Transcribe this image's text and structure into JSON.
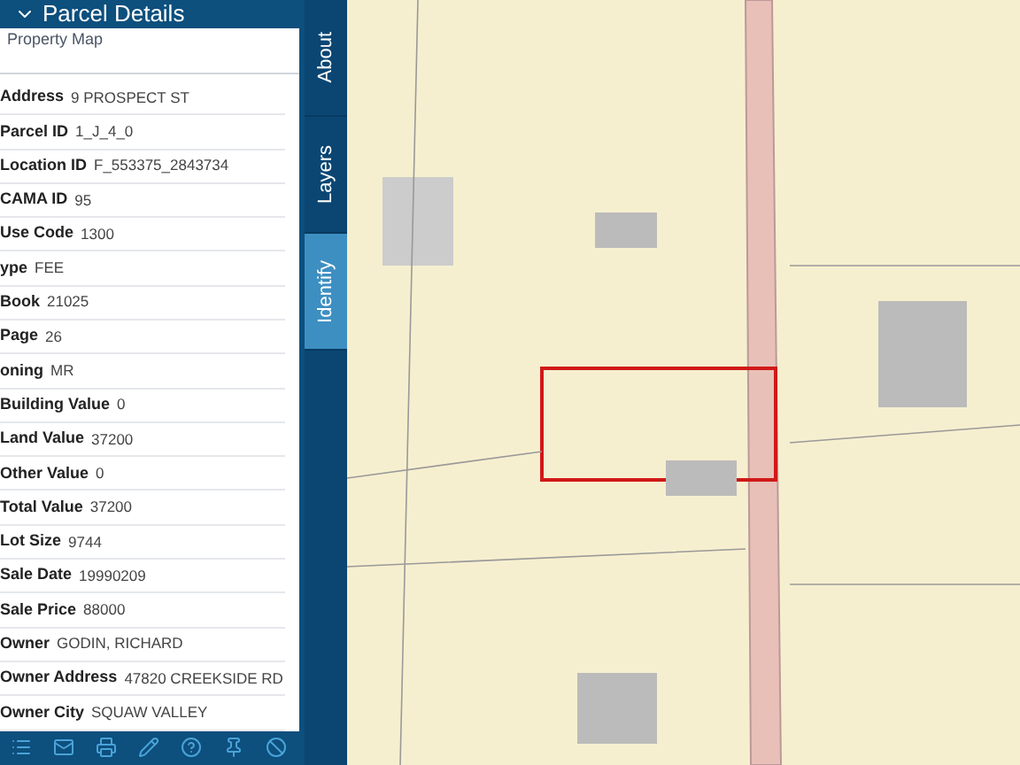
{
  "panel": {
    "title": "Parcel Details",
    "subtitle": "Property Map"
  },
  "fields": [
    {
      "label": "Address",
      "value": "9 PROSPECT ST"
    },
    {
      "label": "Parcel ID",
      "value": "1_J_4_0"
    },
    {
      "label": "Location ID",
      "value": "F_553375_2843734"
    },
    {
      "label": "CAMA ID",
      "value": "95"
    },
    {
      "label": "Use Code",
      "value": "1300"
    },
    {
      "label": "ype",
      "value": "FEE"
    },
    {
      "label": "Book",
      "value": "21025"
    },
    {
      "label": "Page",
      "value": "26"
    },
    {
      "label": "oning",
      "value": "MR"
    },
    {
      "label": "Building Value",
      "value": "0"
    },
    {
      "label": "Land Value",
      "value": "37200"
    },
    {
      "label": "Other Value",
      "value": "0"
    },
    {
      "label": "Total Value",
      "value": "37200"
    },
    {
      "label": "Lot Size",
      "value": "9744"
    },
    {
      "label": "Sale Date",
      "value": "19990209"
    },
    {
      "label": "Sale Price",
      "value": "88000"
    },
    {
      "label": "Owner",
      "value": "GODIN, RICHARD"
    },
    {
      "label": "Owner Address",
      "value": "47820 CREEKSIDE RD"
    },
    {
      "label": "Owner City",
      "value": "SQUAW VALLEY"
    }
  ],
  "tabs": [
    {
      "label": "About",
      "selected": false
    },
    {
      "label": "Layers",
      "selected": false
    },
    {
      "label": "Identify",
      "selected": true
    }
  ]
}
